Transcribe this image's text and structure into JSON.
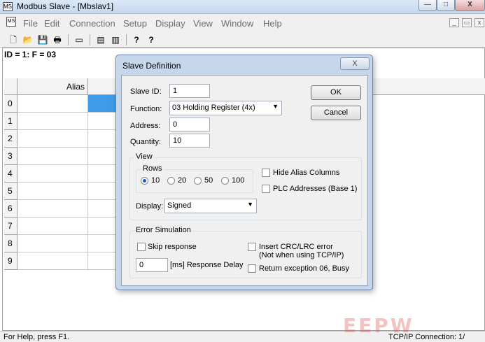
{
  "window": {
    "title": "Modbus Slave - [Mbslav1]",
    "controls": {
      "minimize": "—",
      "maximize": "□",
      "close": "X"
    }
  },
  "menu": {
    "items": [
      "File",
      "Edit",
      "Connection",
      "Setup",
      "Display",
      "View",
      "Window",
      "Help"
    ],
    "mdi_controls": {
      "minimize": "_",
      "restore": "▭",
      "close": "x"
    }
  },
  "toolbar": {
    "icons": [
      "new-document-icon",
      "open-folder-icon",
      "save-icon",
      "print-icon",
      "window-icon",
      "data-log-icon",
      "printer-preview-icon",
      "about-icon",
      "context-help-icon"
    ],
    "glyphs": [
      "🗋",
      "📂",
      "💾",
      "🖶",
      "▭",
      "▤",
      "▥",
      "?",
      "?"
    ]
  },
  "document": {
    "id_line": "ID = 1: F = 03",
    "grid": {
      "alias_header": "Alias",
      "rows": [
        "0",
        "1",
        "2",
        "3",
        "4",
        "5",
        "6",
        "7",
        "8",
        "9"
      ],
      "selected_row": 0
    }
  },
  "dialog": {
    "title": "Slave Definition",
    "close_glyph": "X",
    "slave_id": {
      "label": "Slave ID:",
      "value": "1"
    },
    "function": {
      "label": "Function:",
      "value": "03 Holding Register (4x)"
    },
    "address": {
      "label": "Address:",
      "value": "0"
    },
    "quantity": {
      "label": "Quantity:",
      "value": "10"
    },
    "ok_label": "OK",
    "cancel_label": "Cancel",
    "view": {
      "title": "View",
      "rows_title": "Rows",
      "rows_options": [
        "10",
        "20",
        "50",
        "100"
      ],
      "rows_selected": "10",
      "hide_alias": "Hide Alias Columns",
      "plc_addresses": "PLC Addresses (Base 1)",
      "display_label": "Display:",
      "display_value": "Signed"
    },
    "error_sim": {
      "title": "Error Simulation",
      "skip_response": "Skip response",
      "insert_crc": "Insert CRC/LRC error",
      "insert_crc_note": "(Not when using TCP/IP)",
      "delay_value": "0",
      "delay_label": "[ms] Response Delay",
      "return_exception": "Return exception 06, Busy"
    }
  },
  "status": {
    "left": "For Help, press F1.",
    "right": "TCP/IP Connection: 1/"
  },
  "watermark": "EEPW"
}
